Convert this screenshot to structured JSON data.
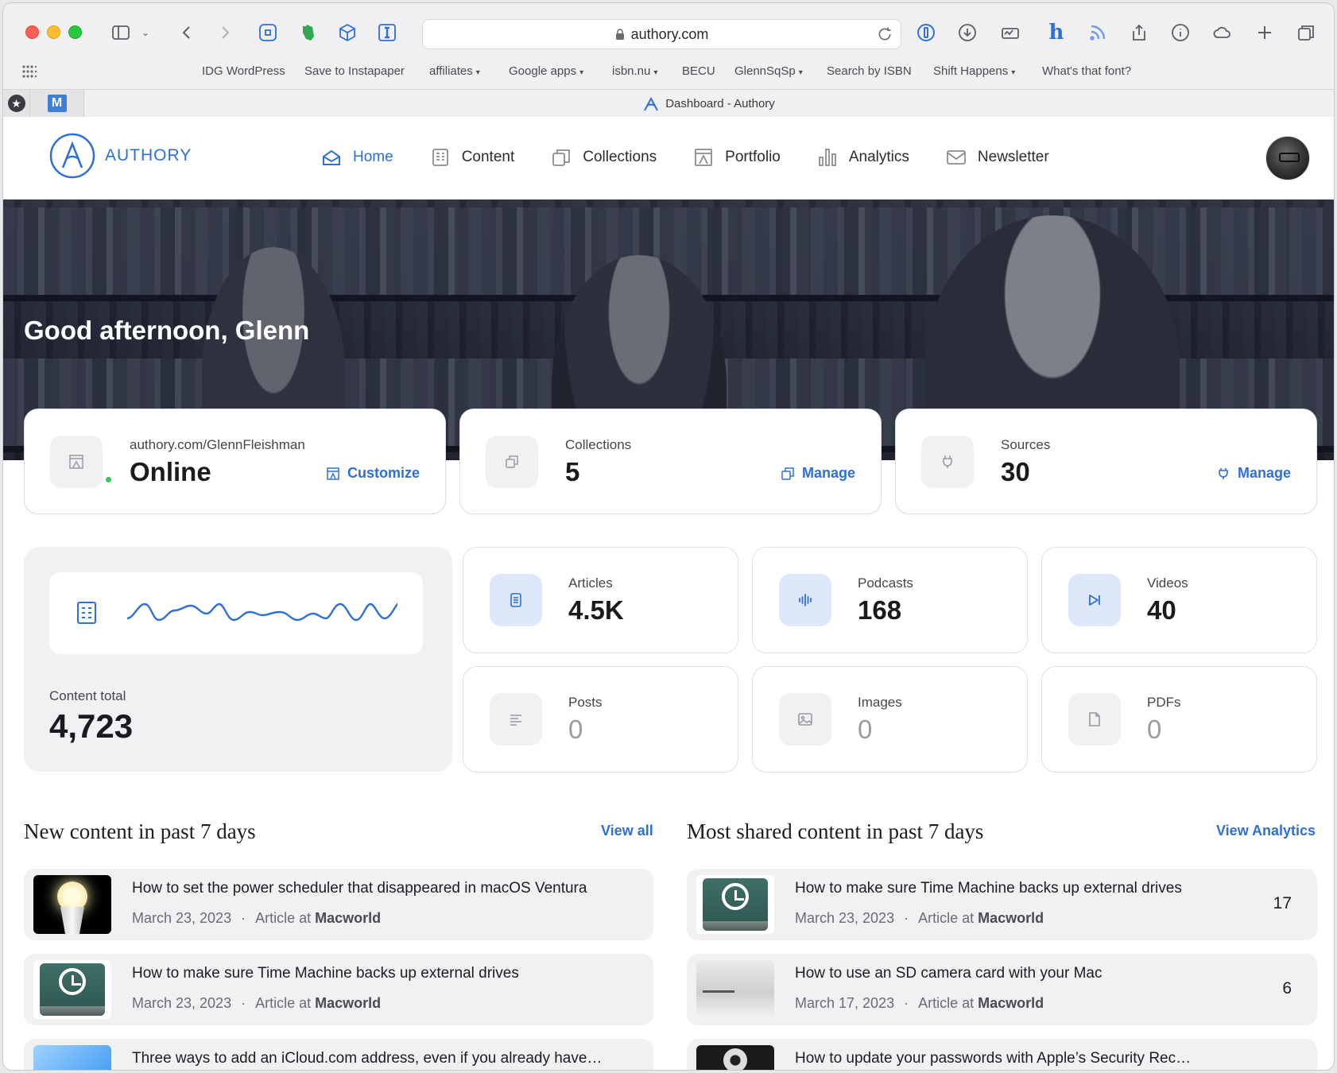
{
  "browser": {
    "url": "authory.com",
    "tab_title": "Dashboard - Authory",
    "bookmarks": [
      {
        "label": "IDG WordPress",
        "dropdown": false
      },
      {
        "label": "Save to Instapaper",
        "dropdown": false
      },
      {
        "label": "affiliates",
        "dropdown": true
      },
      {
        "label": "Google apps",
        "dropdown": true
      },
      {
        "label": "isbn.nu",
        "dropdown": true
      },
      {
        "label": "BECU",
        "dropdown": false
      },
      {
        "label": "GlennSqSp",
        "dropdown": true
      },
      {
        "label": "Search by ISBN",
        "dropdown": false
      },
      {
        "label": "Shift Happens",
        "dropdown": true
      },
      {
        "label": "What's that font?",
        "dropdown": false
      }
    ],
    "pinned_tab_m": "M"
  },
  "app": {
    "brand": "AUTHORY",
    "nav": [
      {
        "label": "Home",
        "icon": "home-icon",
        "active": true
      },
      {
        "label": "Content",
        "icon": "content-icon",
        "active": false
      },
      {
        "label": "Collections",
        "icon": "collections-icon",
        "active": false
      },
      {
        "label": "Portfolio",
        "icon": "portfolio-icon",
        "active": false
      },
      {
        "label": "Analytics",
        "icon": "analytics-icon",
        "active": false
      },
      {
        "label": "Newsletter",
        "icon": "newsletter-icon",
        "active": false
      }
    ],
    "accent_color": "#2f6fd8"
  },
  "hero": {
    "greeting": "Good afternoon, Glenn"
  },
  "summary": {
    "portfolio": {
      "label": "authory.com/GlennFleishman",
      "value": "Online",
      "action": "Customize"
    },
    "collections": {
      "label": "Collections",
      "value": "5",
      "action": "Manage"
    },
    "sources": {
      "label": "Sources",
      "value": "30",
      "action": "Manage"
    }
  },
  "content_total": {
    "label": "Content total",
    "value": "4,723"
  },
  "stats": {
    "articles": {
      "label": "Articles",
      "value": "4.5K"
    },
    "podcasts": {
      "label": "Podcasts",
      "value": "168"
    },
    "videos": {
      "label": "Videos",
      "value": "40"
    },
    "posts": {
      "label": "Posts",
      "value": "0"
    },
    "images": {
      "label": "Images",
      "value": "0"
    },
    "pdfs": {
      "label": "PDFs",
      "value": "0"
    }
  },
  "new_content": {
    "title": "New content in past 7 days",
    "link": "View all",
    "items": [
      {
        "title": "How to set the power scheduler that disappeared in macOS Ventura",
        "date": "March 23, 2023",
        "type": "Article at",
        "source": "Macworld"
      },
      {
        "title": "How to make sure Time Machine backs up external drives",
        "date": "March 23, 2023",
        "type": "Article at",
        "source": "Macworld"
      },
      {
        "title": "Three ways to add an iCloud.com address, even if you already have…"
      }
    ]
  },
  "most_shared": {
    "title": "Most shared content in past 7 days",
    "link": "View Analytics",
    "items": [
      {
        "title": "How to make sure Time Machine backs up external drives",
        "date": "March 23, 2023",
        "type": "Article at",
        "source": "Macworld",
        "count": "17"
      },
      {
        "title": "How to use an SD camera card with your Mac",
        "date": "March 17, 2023",
        "type": "Article at",
        "source": "Macworld",
        "count": "6"
      },
      {
        "title": "How to update your passwords with Apple’s Security Rec…"
      }
    ]
  }
}
